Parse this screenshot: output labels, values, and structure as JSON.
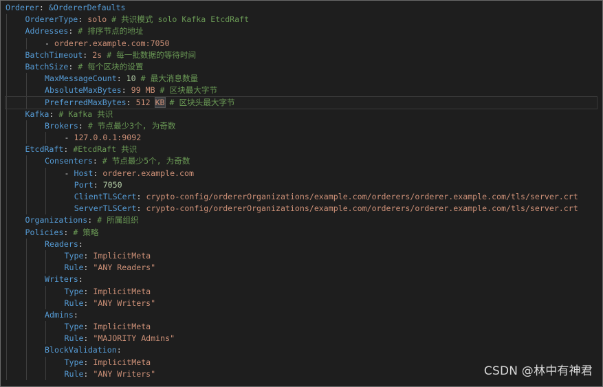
{
  "theme": {
    "background": "#1e1e1e",
    "key_color": "#569cd6",
    "string_color": "#ce9178",
    "number_color": "#b5cea8",
    "comment_color": "#6a9955"
  },
  "lines": [
    {
      "indent": 0,
      "key": "Orderer",
      "anchor": "&OrdererDefaults"
    },
    {
      "indent": 1,
      "key": "OrdererType",
      "value": "solo",
      "comment": "# 共识模式 solo Kafka EtcdRaft"
    },
    {
      "indent": 1,
      "key": "Addresses",
      "comment": "# 排序节点的地址"
    },
    {
      "indent": 2,
      "dash": true,
      "value": "orderer.example.com:7050"
    },
    {
      "indent": 1,
      "key": "BatchTimeout",
      "value": "2s",
      "comment": "# 每一批数据的等待时间"
    },
    {
      "indent": 1,
      "key": "BatchSize",
      "comment": "# 每个区块的设置"
    },
    {
      "indent": 2,
      "key": "MaxMessageCount",
      "value": "10",
      "value_type": "number",
      "comment": "# 最大消息数量"
    },
    {
      "indent": 2,
      "key": "AbsoluteMaxBytes",
      "value": "99 MB",
      "comment": "# 区块最大字节"
    },
    {
      "indent": 2,
      "key": "PreferredMaxBytes",
      "value": "512",
      "value_sel": "KB",
      "comment": "# 区块头最大字节",
      "current": true
    },
    {
      "indent": 1,
      "key": "Kafka",
      "comment": "# Kafka 共识"
    },
    {
      "indent": 2,
      "key": "Brokers",
      "comment": "# 节点最少3个, 为奇数"
    },
    {
      "indent": 3,
      "dash": true,
      "value": "127.0.0.1:9092"
    },
    {
      "indent": 1,
      "key": "EtcdRaft",
      "comment": "#EtcdRaft 共识"
    },
    {
      "indent": 2,
      "key": "Consenters",
      "comment": "# 节点最少5个, 为奇数"
    },
    {
      "indent": 3,
      "dash": true,
      "key": "Host",
      "value": "orderer.example.com"
    },
    {
      "indent": 3,
      "extra": 2,
      "key": "Port",
      "value": "7050",
      "value_type": "number"
    },
    {
      "indent": 3,
      "extra": 2,
      "key": "ClientTLSCert",
      "value": "crypto-config/ordererOrganizations/example.com/orderers/orderer.example.com/tls/server.crt"
    },
    {
      "indent": 3,
      "extra": 2,
      "key": "ServerTLSCert",
      "value": "crypto-config/ordererOrganizations/example.com/orderers/orderer.example.com/tls/server.crt"
    },
    {
      "indent": 1,
      "key": "Organizations",
      "comment": "# 所属组织"
    },
    {
      "indent": 1,
      "key": "Policies",
      "comment": "# 策略"
    },
    {
      "indent": 2,
      "key": "Readers"
    },
    {
      "indent": 3,
      "key": "Type",
      "value": "ImplicitMeta"
    },
    {
      "indent": 3,
      "key": "Rule",
      "value": "\"ANY Readers\""
    },
    {
      "indent": 2,
      "key": "Writers"
    },
    {
      "indent": 3,
      "key": "Type",
      "value": "ImplicitMeta"
    },
    {
      "indent": 3,
      "key": "Rule",
      "value": "\"ANY Writers\""
    },
    {
      "indent": 2,
      "key": "Admins"
    },
    {
      "indent": 3,
      "key": "Type",
      "value": "ImplicitMeta"
    },
    {
      "indent": 3,
      "key": "Rule",
      "value": "\"MAJORITY Admins\""
    },
    {
      "indent": 2,
      "key": "BlockValidation"
    },
    {
      "indent": 3,
      "key": "Type",
      "value": "ImplicitMeta"
    },
    {
      "indent": 3,
      "key": "Rule",
      "value": "\"ANY Writers\""
    }
  ],
  "watermark": "CSDN @林中有神君"
}
